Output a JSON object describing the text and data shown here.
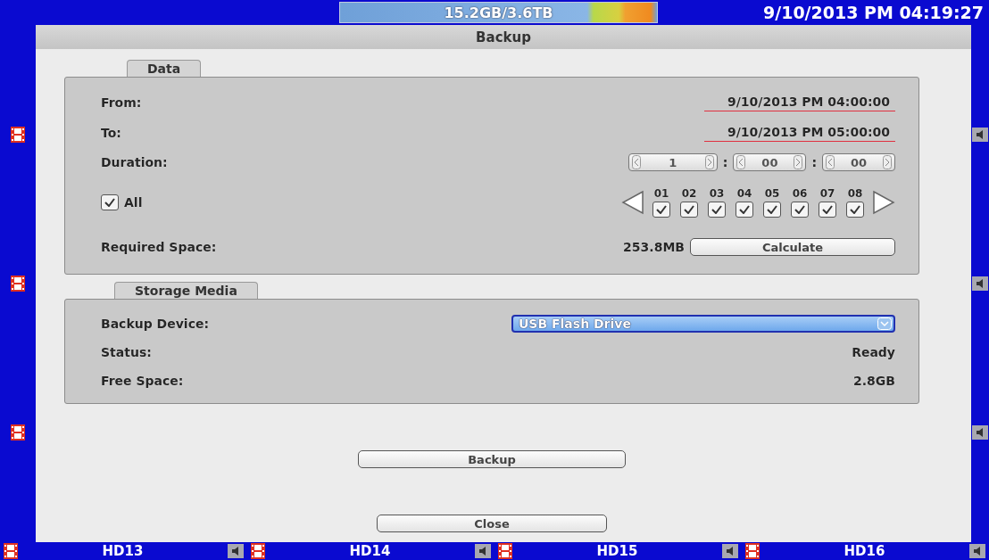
{
  "top_bar": {
    "storage": "15.2GB/3.6TB",
    "datetime": "9/10/2013 PM 04:19:27"
  },
  "dialog": {
    "title": "Backup",
    "data_group": {
      "title": "Data",
      "from": {
        "label": "From:",
        "value": "9/10/2013 PM 04:00:00"
      },
      "to": {
        "label": "To:",
        "value": "9/10/2013 PM 05:00:00"
      },
      "duration": {
        "label": "Duration:",
        "fields": [
          "1",
          "00",
          "00"
        ],
        "separators": [
          ":",
          ":"
        ]
      },
      "all": {
        "label": "All",
        "checked": true
      },
      "channels": [
        {
          "label": "01",
          "checked": true
        },
        {
          "label": "02",
          "checked": true
        },
        {
          "label": "03",
          "checked": true
        },
        {
          "label": "04",
          "checked": true
        },
        {
          "label": "05",
          "checked": true
        },
        {
          "label": "06",
          "checked": true
        },
        {
          "label": "07",
          "checked": true
        },
        {
          "label": "08",
          "checked": true
        }
      ],
      "required_space": {
        "label": "Required Space:",
        "value": "253.8MB",
        "button": "Calculate"
      }
    },
    "storage_group": {
      "title": "Storage Media",
      "device": {
        "label": "Backup Device:",
        "value": "USB Flash Drive"
      },
      "status": {
        "label": "Status:",
        "value": "Ready"
      },
      "free_space": {
        "label": "Free Space:",
        "value": "2.8GB"
      }
    },
    "buttons": [
      "Backup",
      "Close"
    ]
  },
  "cameras": [
    {
      "label": "HD13"
    },
    {
      "label": "HD14"
    },
    {
      "label": "HD15"
    },
    {
      "label": "HD16"
    }
  ]
}
